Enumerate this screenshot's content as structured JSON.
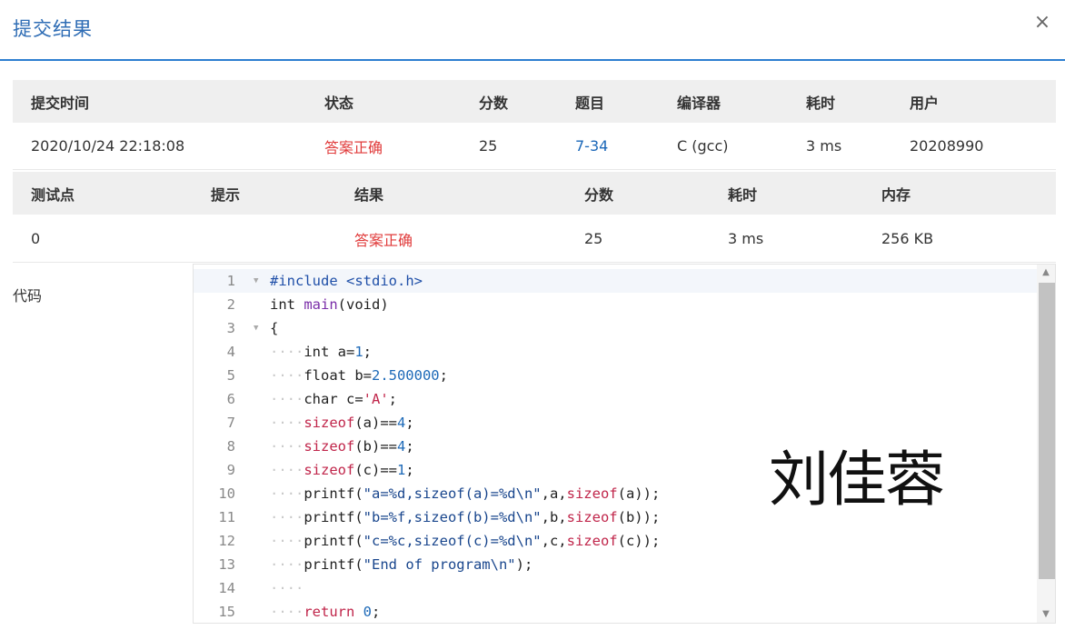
{
  "dialog": {
    "title": "提交结果",
    "close_glyph": "×"
  },
  "submission": {
    "headers": [
      "提交时间",
      "状态",
      "分数",
      "题目",
      "编译器",
      "耗时",
      "用户"
    ],
    "row": {
      "time": "2020/10/24 22:18:08",
      "status": "答案正确",
      "score": "25",
      "problem": "7-34",
      "compiler": "C (gcc)",
      "duration": "3 ms",
      "user": "20208990"
    }
  },
  "tests": {
    "headers": [
      "测试点",
      "提示",
      "结果",
      "分数",
      "耗时",
      "内存"
    ],
    "row": {
      "id": "0",
      "hint": "",
      "result": "答案正确",
      "score": "25",
      "duration": "3 ms",
      "memory": "256 KB"
    }
  },
  "code": {
    "label": "代码",
    "lines": [
      "#include <stdio.h>",
      "int main(void)",
      "{",
      "    int a=1;",
      "    float b=2.500000;",
      "    char c='A';",
      "    sizeof(a)==4;",
      "    sizeof(b)==4;",
      "    sizeof(c)==1;",
      "    printf(\"a=%d,sizeof(a)=%d\\n\",a,sizeof(a));",
      "    printf(\"b=%f,sizeof(b)=%d\\n\",b,sizeof(b));",
      "    printf(\"c=%c,sizeof(c)=%d\\n\",c,sizeof(c));",
      "    printf(\"End of program\\n\");",
      "    ",
      "    return 0;"
    ]
  },
  "watermark": "刘佳蓉",
  "colors": {
    "accent": "#2d7fd0",
    "title": "#2f6db5",
    "correct": "#e03a3a",
    "link": "#1a67b8"
  }
}
